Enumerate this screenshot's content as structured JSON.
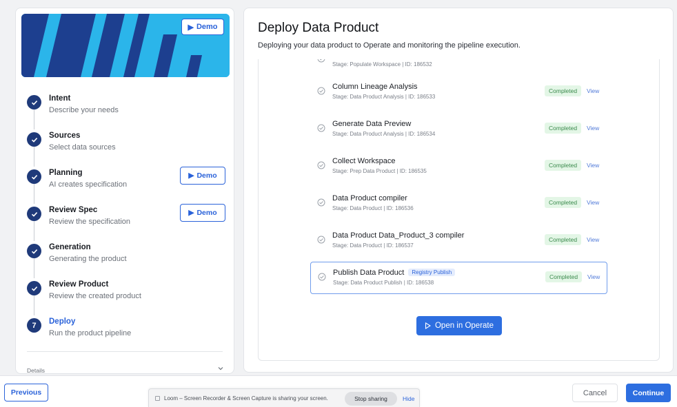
{
  "banner": {
    "demo_label": "Demo"
  },
  "steps": [
    {
      "title": "Intent",
      "subtitle": "Describe your needs",
      "state": "done"
    },
    {
      "title": "Sources",
      "subtitle": "Select data sources",
      "state": "done"
    },
    {
      "title": "Planning",
      "subtitle": "AI creates specification",
      "state": "done",
      "demo_label": "Demo"
    },
    {
      "title": "Review Spec",
      "subtitle": "Review the specification",
      "state": "done",
      "demo_label": "Demo"
    },
    {
      "title": "Generation",
      "subtitle": "Generating the product",
      "state": "done"
    },
    {
      "title": "Review Product",
      "subtitle": "Review the created product",
      "state": "done"
    },
    {
      "title": "Deploy",
      "subtitle": "Run the product pipeline",
      "state": "active",
      "number": "7"
    }
  ],
  "details_label": "Details",
  "main": {
    "title": "Deploy Data Product",
    "subtitle": "Deploying your data product to Operate and monitoring the pipeline execution.",
    "open_button_label": "Open in Operate"
  },
  "pipeline": [
    {
      "name": "",
      "meta": "Stage: Populate Workspace | ID: 186532",
      "status": "",
      "view": ""
    },
    {
      "name": "Column Lineage Analysis",
      "meta": "Stage: Data Product Analysis | ID: 186533",
      "status": "Completed",
      "view": "View"
    },
    {
      "name": "Generate Data Preview",
      "meta": "Stage: Data Product Analysis | ID: 186534",
      "status": "Completed",
      "view": "View"
    },
    {
      "name": "Collect Workspace",
      "meta": "Stage: Prep Data Product | ID: 186535",
      "status": "Completed",
      "view": "View"
    },
    {
      "name": "Data Product compiler",
      "meta": "Stage: Data Product | ID: 186536",
      "status": "Completed",
      "view": "View"
    },
    {
      "name": "Data Product Data_Product_3 compiler",
      "meta": "Stage: Data Product | ID: 186537",
      "status": "Completed",
      "view": "View"
    },
    {
      "name": "Publish Data Product",
      "tag": "Registry Publish",
      "meta": "Stage: Data Product Publish | ID: 186538",
      "status": "Completed",
      "view": "View"
    }
  ],
  "footer": {
    "previous_label": "Previous",
    "cancel_label": "Cancel",
    "continue_label": "Continue"
  },
  "share_bar": {
    "text": "Loom – Screen Recorder & Screen Capture is sharing your screen.",
    "stop_label": "Stop sharing",
    "hide_label": "Hide"
  },
  "colors": {
    "accent": "#2a62d9",
    "primary_button": "#2d6ee0",
    "step_done": "#1f3a7a",
    "banner_light": "#2bb5ea",
    "banner_dark": "#1d3f8f",
    "status_bg": "#e3f6e6",
    "status_text": "#3a8a4c"
  }
}
